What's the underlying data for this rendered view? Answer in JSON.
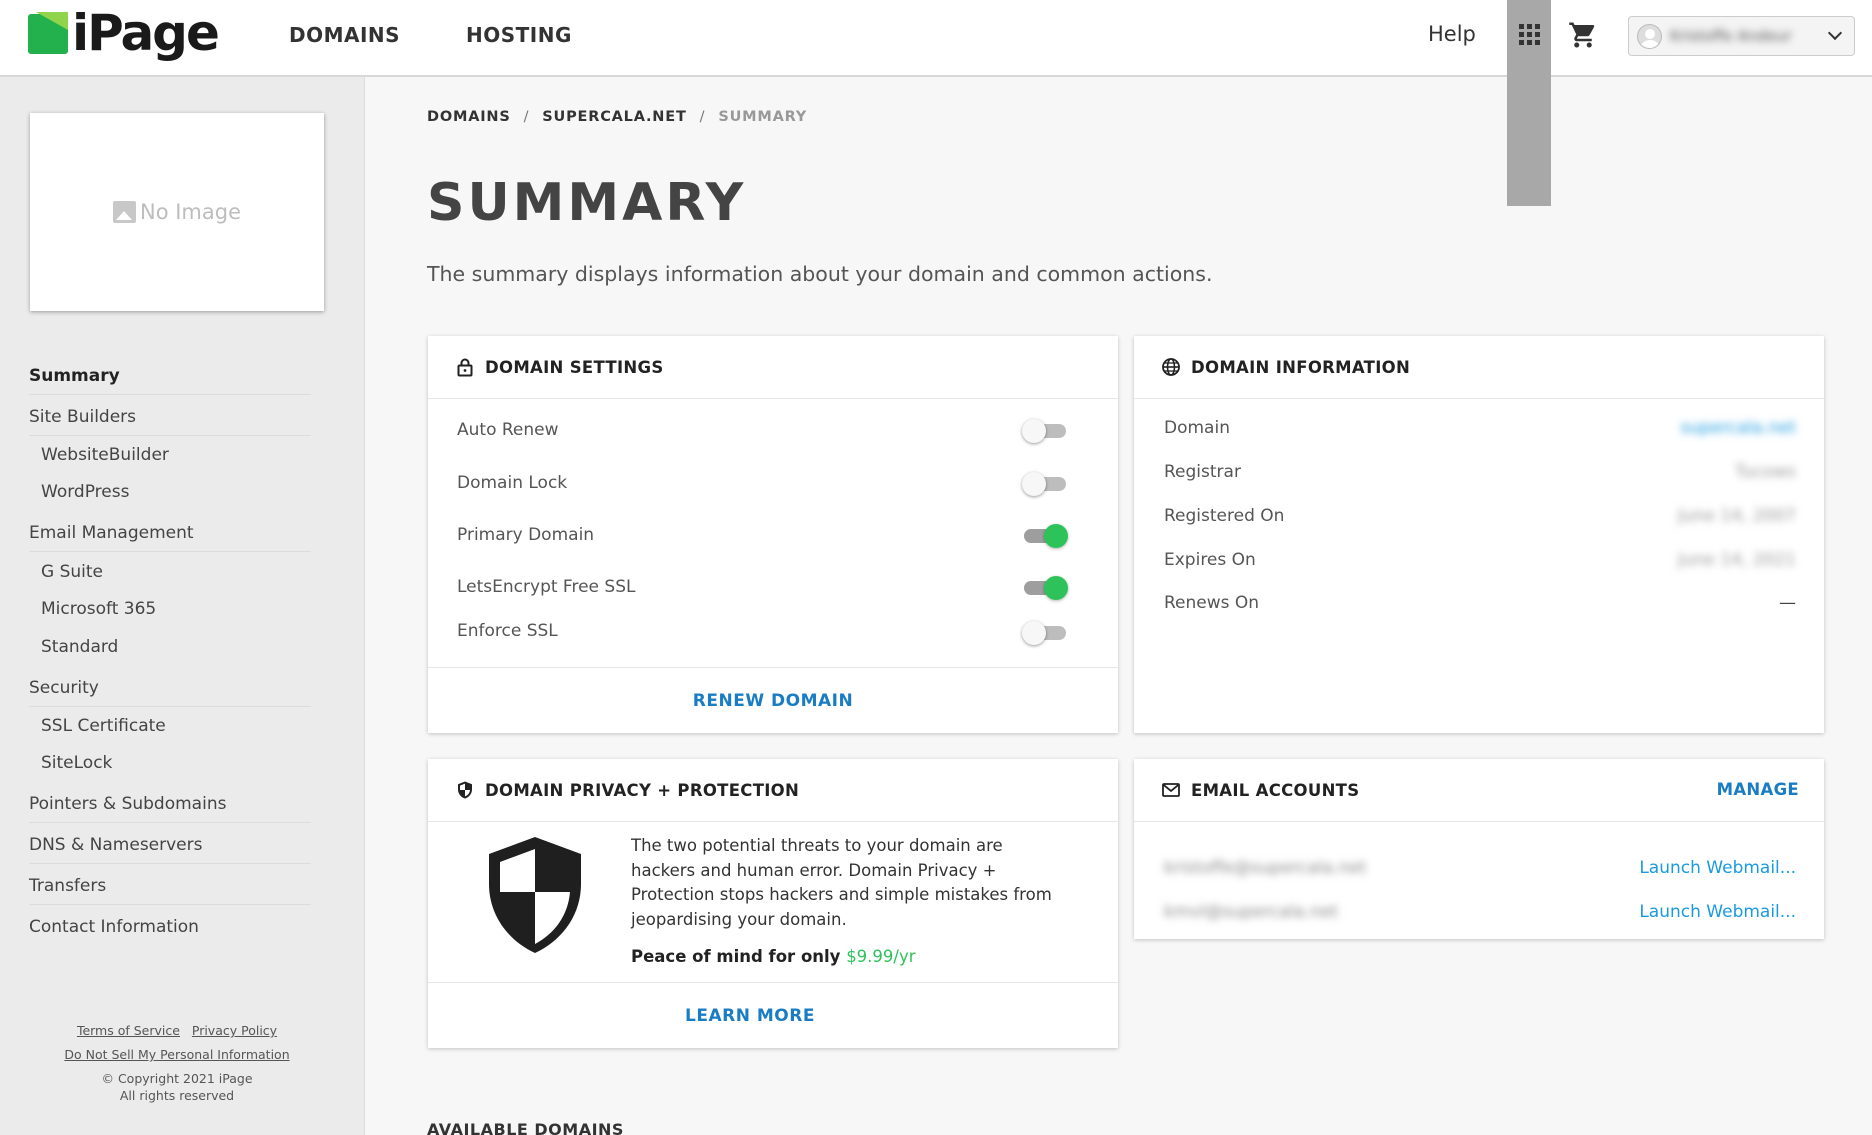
{
  "header": {
    "logo": "iPage",
    "nav": [
      "DOMAINS",
      "HOSTING"
    ],
    "help": "Help",
    "user_name": "Kristoffe Andeur"
  },
  "sidebar": {
    "no_image": "No Image",
    "items": [
      {
        "label": "Summary",
        "level": "top",
        "active": true
      },
      {
        "label": "Site Builders",
        "level": "top"
      },
      {
        "label": "WebsiteBuilder",
        "level": "sub"
      },
      {
        "label": "WordPress",
        "level": "sub"
      },
      {
        "label": "Email Management",
        "level": "top"
      },
      {
        "label": "G Suite",
        "level": "sub"
      },
      {
        "label": "Microsoft 365",
        "level": "sub"
      },
      {
        "label": "Standard",
        "level": "sub"
      },
      {
        "label": "Security",
        "level": "top"
      },
      {
        "label": "SSL Certificate",
        "level": "sub"
      },
      {
        "label": "SiteLock",
        "level": "sub"
      },
      {
        "label": "Pointers & Subdomains",
        "level": "top"
      },
      {
        "label": "DNS & Nameservers",
        "level": "top"
      },
      {
        "label": "Transfers",
        "level": "top"
      },
      {
        "label": "Contact Information",
        "level": "top"
      }
    ],
    "footer": {
      "terms": "Terms of Service",
      "privacy": "Privacy Policy",
      "do_not_sell": "Do Not Sell My Personal Information",
      "copyright": "© Copyright 2021 iPage",
      "rights": "All rights reserved"
    }
  },
  "breadcrumb": {
    "root": "DOMAINS",
    "domain": "SUPERCALA.NET",
    "current": "SUMMARY",
    "separator": "/"
  },
  "page": {
    "title": "SUMMARY",
    "description": "The summary displays information about your domain and common actions."
  },
  "domain_settings": {
    "title": "DOMAIN SETTINGS",
    "toggles": [
      {
        "label": "Auto Renew",
        "on": false
      },
      {
        "label": "Domain Lock",
        "on": false
      },
      {
        "label": "Primary Domain",
        "on": true
      },
      {
        "label": "LetsEncrypt Free SSL",
        "on": true
      },
      {
        "label": "Enforce SSL",
        "on": false
      }
    ],
    "action": "RENEW DOMAIN"
  },
  "domain_info": {
    "title": "DOMAIN INFORMATION",
    "rows": [
      {
        "label": "Domain",
        "value": "supercala.net",
        "link": true
      },
      {
        "label": "Registrar",
        "value": "Tucows"
      },
      {
        "label": "Registered On",
        "value": "June 14, 2007"
      },
      {
        "label": "Expires On",
        "value": "June 14, 2021"
      },
      {
        "label": "Renews On",
        "value": "—",
        "dash": true
      }
    ]
  },
  "privacy": {
    "title": "DOMAIN PRIVACY + PROTECTION",
    "text": "The two potential threats to your domain are hackers and human error. Domain Privacy + Protection stops hackers and simple mistakes from jeopardising your domain.",
    "peace_label": "Peace of mind for only ",
    "price": "$9.99/yr",
    "action": "LEARN MORE"
  },
  "email": {
    "title": "EMAIL ACCOUNTS",
    "manage": "MANAGE",
    "accounts": [
      {
        "address": "kristoffe@supercala.net",
        "action": "Launch Webmail..."
      },
      {
        "address": "kmvl@supercala.net",
        "action": "Launch Webmail..."
      }
    ]
  },
  "available_title": "AVAILABLE DOMAINS",
  "colors": {
    "accent": "#1a7dc3",
    "toggle_on": "#2ec35a",
    "brand_green": "#22b14c"
  }
}
